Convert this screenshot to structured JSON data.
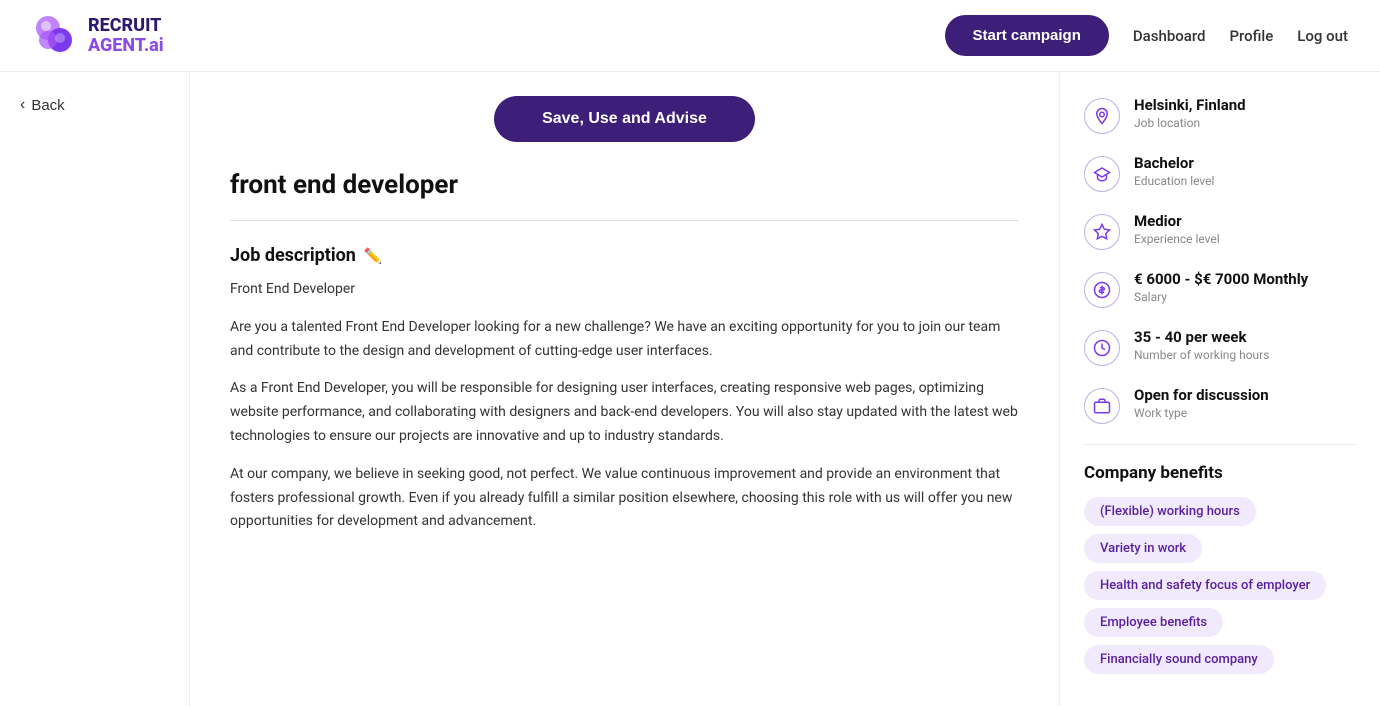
{
  "header": {
    "logo_line1": "RECRUIT",
    "logo_line2": "AGENT.ai",
    "start_campaign_label": "Start campaign",
    "dashboard_label": "Dashboard",
    "profile_label": "Profile",
    "logout_label": "Log out"
  },
  "sidebar": {
    "back_label": "Back"
  },
  "content": {
    "save_button_label": "Save, Use and Advise",
    "job_title": "front end developer",
    "job_description_heading": "Job description",
    "job_description_intro": "Front End Developer",
    "job_description_para1": "Are you a talented Front End Developer looking for a new challenge? We have an exciting opportunity for you to join our team and contribute to the design and development of cutting-edge user interfaces.",
    "job_description_para2": "As a Front End Developer, you will be responsible for designing user interfaces, creating responsive web pages, optimizing website performance, and collaborating with designers and back-end developers. You will also stay updated with the latest web technologies to ensure our projects are innovative and up to industry standards.",
    "job_description_para3": "At our company, we believe in seeking good, not perfect. We value continuous improvement and provide an environment that fosters professional growth. Even if you already fulfill a similar position elsewhere, choosing this role with us will offer you new opportunities for development and advancement."
  },
  "right_panel": {
    "job_location_value": "Helsinki, Finland",
    "job_location_label": "Job location",
    "education_value": "Bachelor",
    "education_label": "Education level",
    "experience_value": "Medior",
    "experience_label": "Experience level",
    "salary_value": "€ 6000 - $€ 7000 Monthly",
    "salary_label": "Salary",
    "hours_value": "35 - 40 per week",
    "hours_label": "Number of working hours",
    "work_type_value": "Open for discussion",
    "work_type_label": "Work type",
    "benefits_heading": "Company benefits",
    "benefits": [
      "(Flexible) working hours",
      "Variety in work",
      "Health and safety focus of employer",
      "Employee benefits",
      "Financially sound company"
    ]
  }
}
